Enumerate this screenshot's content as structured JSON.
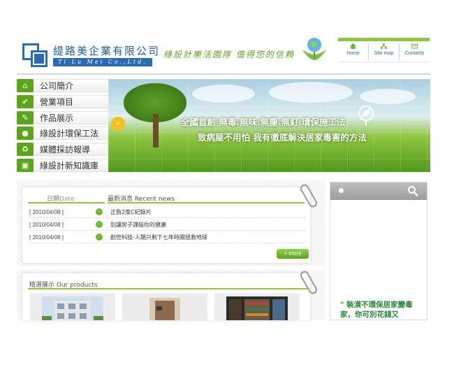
{
  "header": {
    "company_name": "緹路美企業有限公司",
    "company_en": "Ti Lu Mei Co.,Ltd.",
    "slogan": "綠設計樂活園隊 值得您的信賴"
  },
  "topnav": [
    {
      "label": "Home",
      "icon": "home-icon"
    },
    {
      "label": "Site map",
      "icon": "sitemap-icon"
    },
    {
      "label": "Contacts",
      "icon": "mail-icon"
    }
  ],
  "menu": [
    {
      "label": "公司簡介",
      "icon": "home-icon"
    },
    {
      "label": "營業項目",
      "icon": "check-icon"
    },
    {
      "label": "作品展示",
      "icon": "wrench-icon"
    },
    {
      "label": "綠設計環保工法",
      "icon": "person-icon"
    },
    {
      "label": "媒體採訪報導",
      "icon": "recycle-icon"
    },
    {
      "label": "綠設計新知識庫",
      "icon": "lock-icon"
    }
  ],
  "banner": {
    "headline1": "全國首創 無毒.無味.無塵.無釘 環保施工法",
    "headline2": "致病屋不用怕 我有徹底解決居家毒害的方法"
  },
  "news": {
    "date_header_zh": "日期",
    "date_header_en": "Date",
    "title_header": "最新消息 Recent news",
    "items": [
      {
        "date": "[ 2010/04/08 ]",
        "title": "正負2度C紀錄片"
      },
      {
        "date": "[ 2010/04/08 ]",
        "title": "別讓房子謀殺你的健康"
      },
      {
        "date": "[ 2010/04/08 ]",
        "title": "創世科技-人類只剩下七年時間拯救地球"
      }
    ],
    "more_label": "+ more"
  },
  "products": {
    "title": "精選展示 Our products"
  },
  "sidebar": {
    "text": "\" 裝潢不環保居家變毒家，你可別花錢又"
  },
  "colors": {
    "accent_green": "#8dc63f",
    "menu_green": "#5aa51a",
    "brand_blue": "#2a6bb5"
  }
}
